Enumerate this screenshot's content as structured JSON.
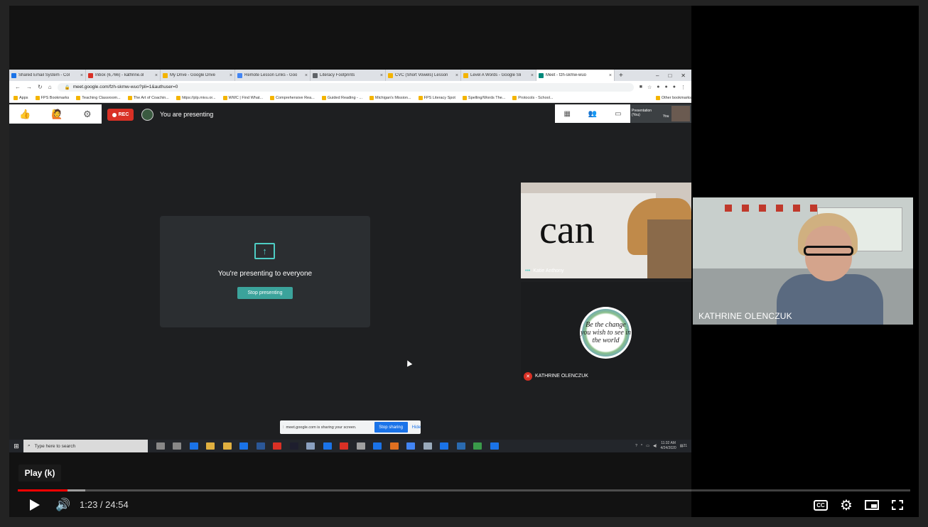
{
  "browser": {
    "tabs": [
      {
        "label": "Shared Email System - Col",
        "color": "#1a73e8"
      },
      {
        "label": "Inbox (6,766) - kathrine.ol",
        "color": "#d93025"
      },
      {
        "label": "My Drive - Google Drive",
        "color": "#f4b400"
      },
      {
        "label": "Remote Lesson Links - Goo",
        "color": "#4285f4"
      },
      {
        "label": "Literacy Footprints",
        "color": "#5f6368"
      },
      {
        "label": "CVC (Short Vowels) Lesson",
        "color": "#f4b400"
      },
      {
        "label": "Level A Words - Google Sli",
        "color": "#f4b400"
      },
      {
        "label": "Meet - fzh-skmw-wuo",
        "color": "#00897b"
      }
    ],
    "url": "meet.google.com/fzh-skmw-wuo?pli=1&authuser=0",
    "bookmarks": [
      "Apps",
      "FPS Bookmarks",
      "Teaching Classroom...",
      "The Art of Coachin...",
      "https://plp.mivu.or...",
      "WWC | Find What...",
      "Comprehensive Rea...",
      "Guided Reading - ...",
      "Michigan's Mission...",
      "FPS Literacy Spot",
      "Spelling/Words The...",
      "Protocols - School...",
      "Other bookmarks"
    ]
  },
  "meet": {
    "rec_label": "REC",
    "presenting_label": "You are presenting",
    "present_card_text": "You're presenting to everyone",
    "stop_presenting_label": "Stop presenting",
    "self_thumb_label": "Presentation (You)",
    "self_thumb_you": "You",
    "participants": [
      {
        "name": "Katie Anthony",
        "board_text": "can"
      },
      {
        "name": "KATHRINE OLENCZUK",
        "logo_text": "Be the change you wish to see in the world"
      }
    ],
    "share_bar_text": "meet.google.com is sharing your screen.",
    "stop_sharing_label": "Stop sharing",
    "hide_label": "Hide"
  },
  "taskbar": {
    "search_placeholder": "Type here to search",
    "time": "11:32 AM",
    "date": "4/24/2020",
    "notif_count": "21"
  },
  "camera": {
    "name": "KATHRINE OLENCZUK"
  },
  "player": {
    "tooltip": "Play (k)",
    "current_time": "1:23",
    "duration": "24:54",
    "timecode": "1:23 / 24:54",
    "played_fraction": 0.0556,
    "buffered_fraction": 0.076,
    "cc_label": "CC"
  },
  "colors": {
    "progress_played": "#ff0000",
    "meet_accent": "#3ba39b",
    "rec_red": "#d93025"
  }
}
